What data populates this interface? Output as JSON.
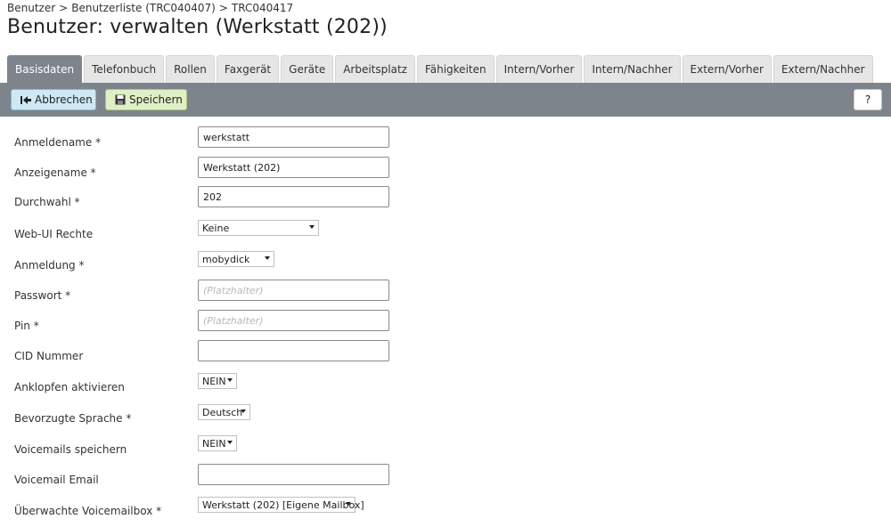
{
  "breadcrumb": {
    "items": [
      "Benutzer",
      "Benutzerliste (TRC040407)",
      "TRC040417"
    ],
    "separator": ">"
  },
  "page": {
    "title": "Benutzer: verwalten (Werkstatt (202))"
  },
  "tabs": [
    {
      "label": "Basisdaten",
      "active": true
    },
    {
      "label": "Telefonbuch"
    },
    {
      "label": "Rollen"
    },
    {
      "label": "Faxgerät"
    },
    {
      "label": "Geräte"
    },
    {
      "label": "Arbeitsplatz"
    },
    {
      "label": "Fähigkeiten"
    },
    {
      "label": "Intern/Vorher"
    },
    {
      "label": "Intern/Nachher"
    },
    {
      "label": "Extern/Vorher"
    },
    {
      "label": "Extern/Nachher"
    }
  ],
  "toolbar": {
    "cancel_label": "Abbrechen",
    "save_label": "Speichern",
    "help_label": "?"
  },
  "form": {
    "anmeldename": {
      "label": "Anmeldename *",
      "value": "werkstatt"
    },
    "anzeigename": {
      "label": "Anzeigename *",
      "value": "Werkstatt (202)"
    },
    "durchwahl": {
      "label": "Durchwahl *",
      "value": "202"
    },
    "webui": {
      "label": "Web-UI Rechte",
      "selected": "Keine"
    },
    "anmeldung": {
      "label": "Anmeldung *",
      "selected": "mobydick"
    },
    "passwort": {
      "label": "Passwort *",
      "placeholder": "(Platzhalter)"
    },
    "pin": {
      "label": "Pin *",
      "placeholder": "(Platzhalter)"
    },
    "cid": {
      "label": "CID Nummer",
      "value": ""
    },
    "anklopfen": {
      "label": "Anklopfen aktivieren",
      "selected": "NEIN"
    },
    "sprache": {
      "label": "Bevorzugte Sprache *",
      "selected": "Deutsch"
    },
    "voicemails": {
      "label": "Voicemails speichern",
      "selected": "NEIN"
    },
    "vmemail": {
      "label": "Voicemail Email",
      "value": ""
    },
    "mailbox": {
      "label": "Überwachte Voicemailbox *",
      "selected": "Werkstatt (202) [Eigene Mailbox]"
    }
  }
}
